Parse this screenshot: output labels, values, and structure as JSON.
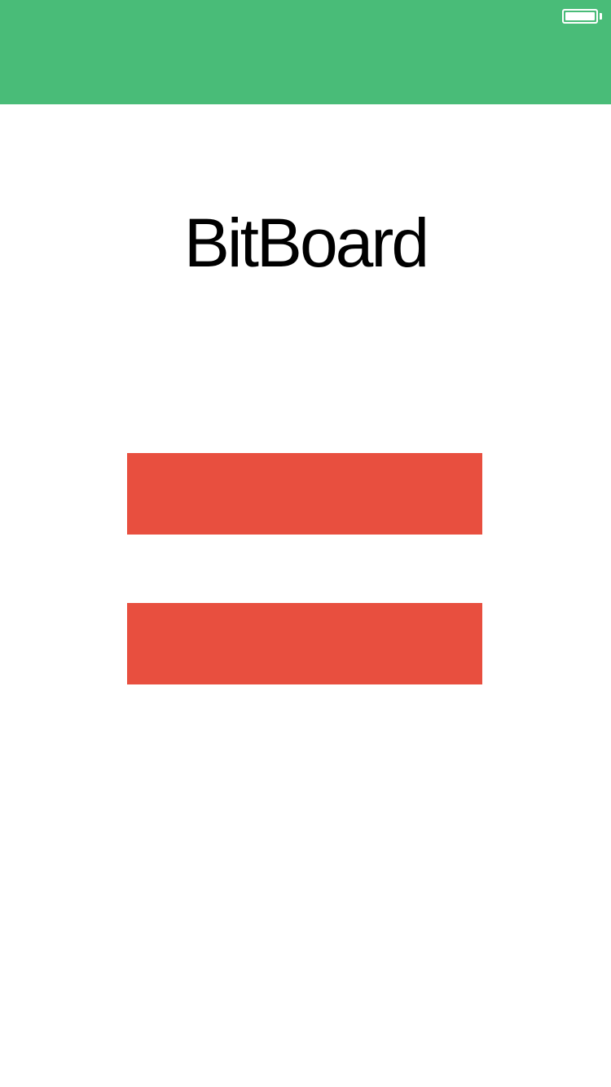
{
  "header": {
    "background": "#49bc78"
  },
  "status_bar": {
    "battery_icon": "battery-full-icon",
    "battery_level": 1.0
  },
  "main": {
    "title": "BitBoard",
    "buttons": [
      {
        "label": "",
        "color": "#e84f3f"
      },
      {
        "label": "",
        "color": "#e84f3f"
      }
    ]
  }
}
